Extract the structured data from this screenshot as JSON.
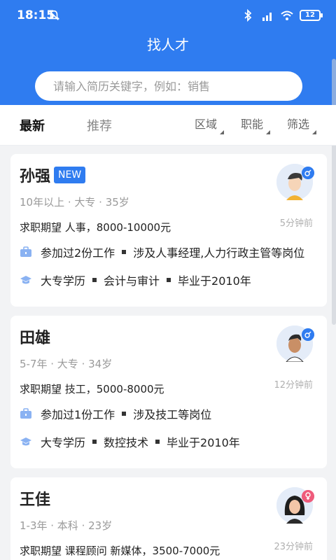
{
  "status": {
    "time": "18:15",
    "battery": "12"
  },
  "header": {
    "title": "找人才",
    "search_placeholder": "请输入简历关键字，例如：销售"
  },
  "tabs": {
    "latest": "最新",
    "recommend": "推荐"
  },
  "filters": {
    "area": "区域",
    "function": "职能",
    "screen": "筛选"
  },
  "candidates": [
    {
      "name": "孙强",
      "badge": "NEW",
      "meta": "10年以上 · 大专 · 35岁",
      "expect": "求职期望 人事，8000-10000元",
      "time": "5分钟前",
      "work": [
        "参加过2份工作",
        "涉及人事经理,人力行政主管等岗位"
      ],
      "edu": [
        "大专学历",
        "会计与审计",
        "毕业于2010年"
      ],
      "gender": "male"
    },
    {
      "name": "田雄",
      "meta": "5-7年 · 大专 · 34岁",
      "expect": "求职期望 技工，5000-8000元",
      "time": "12分钟前",
      "work": [
        "参加过1份工作",
        "涉及技工等岗位"
      ],
      "edu": [
        "大专学历",
        "数控技术",
        "毕业于2010年"
      ],
      "gender": "male"
    },
    {
      "name": "王佳",
      "meta": "1-3年 · 本科 · 23岁",
      "expect": "求职期望 课程顾问 新媒体，3500-7000元",
      "time": "23分钟前",
      "gender": "female"
    }
  ],
  "colors": {
    "primary": "#2f7cf0",
    "female": "#ef5b7b"
  }
}
